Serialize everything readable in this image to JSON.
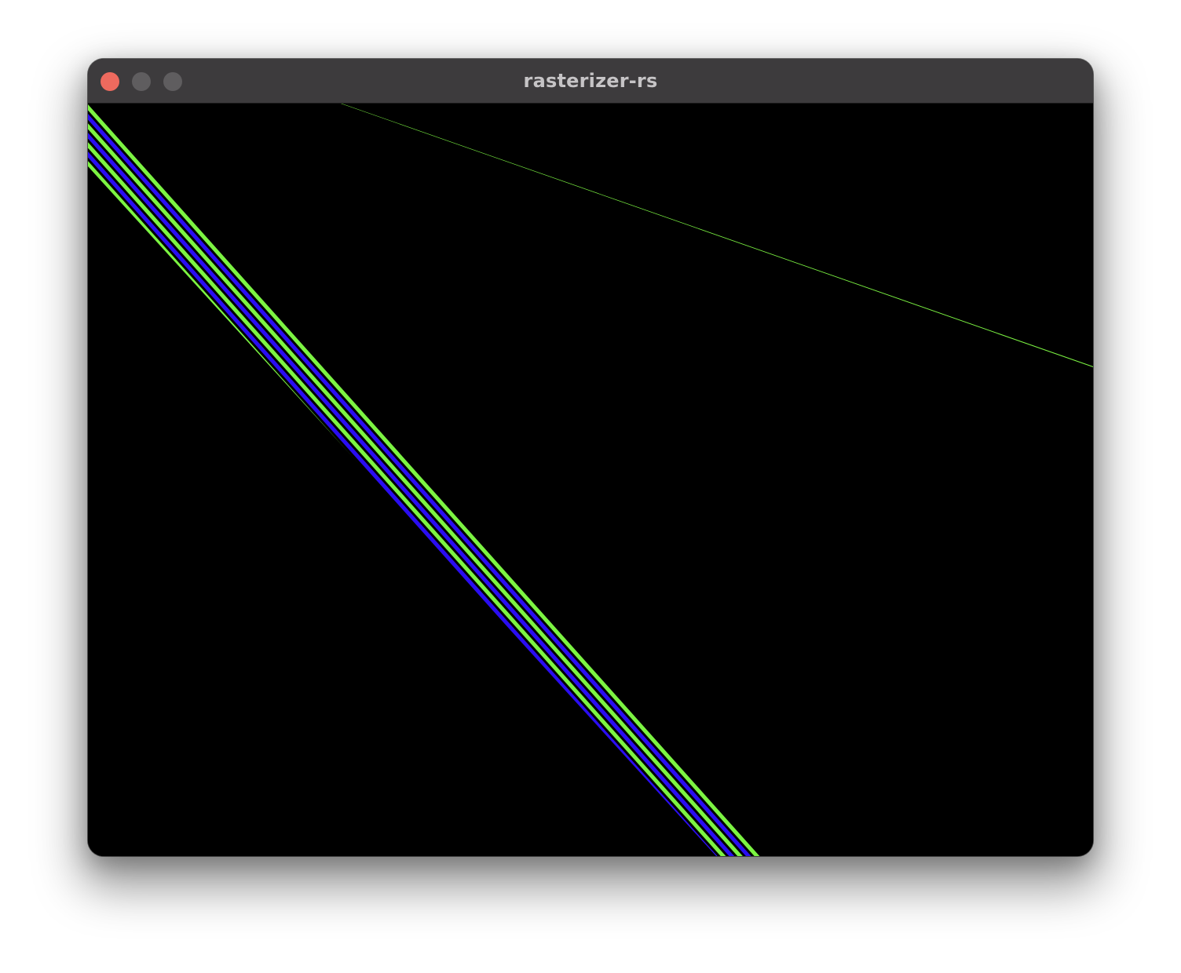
{
  "window": {
    "title": "rasterizer-rs",
    "controls": {
      "close_color": "#ee6a5e",
      "minimize_color": "#5f5d5f",
      "zoom_color": "#5f5d5f"
    }
  },
  "canvas": {
    "background": "#000000",
    "stripe_colors": [
      "#7cf442",
      "#2a0df2"
    ]
  }
}
